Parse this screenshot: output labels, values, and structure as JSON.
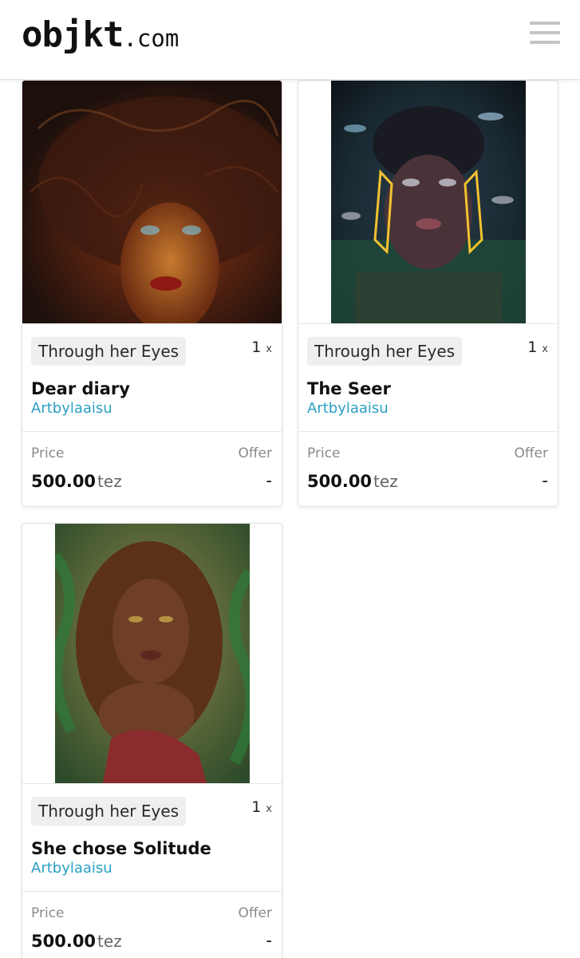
{
  "header": {
    "logo_main": "objkt",
    "logo_tld": ".com"
  },
  "cards": [
    {
      "collection": "Through her Eyes",
      "edition_count": "1",
      "edition_suffix": "x",
      "title": "Dear diary",
      "artist": "Artbylaaisu",
      "price_label": "Price",
      "offer_label": "Offer",
      "price_amount": "500.00",
      "price_currency": "tez",
      "offer_value": "-"
    },
    {
      "collection": "Through her Eyes",
      "edition_count": "1",
      "edition_suffix": "x",
      "title": "The Seer",
      "artist": "Artbylaaisu",
      "price_label": "Price",
      "offer_label": "Offer",
      "price_amount": "500.00",
      "price_currency": "tez",
      "offer_value": "-"
    },
    {
      "collection": "Through her Eyes",
      "edition_count": "1",
      "edition_suffix": "x",
      "title": "She chose Solitude",
      "artist": "Artbylaaisu",
      "price_label": "Price",
      "offer_label": "Offer",
      "price_amount": "500.00",
      "price_currency": "tez",
      "offer_value": "-"
    }
  ],
  "colors": {
    "artist_link": "#2a9fc4",
    "badge_bg": "#efefef"
  }
}
